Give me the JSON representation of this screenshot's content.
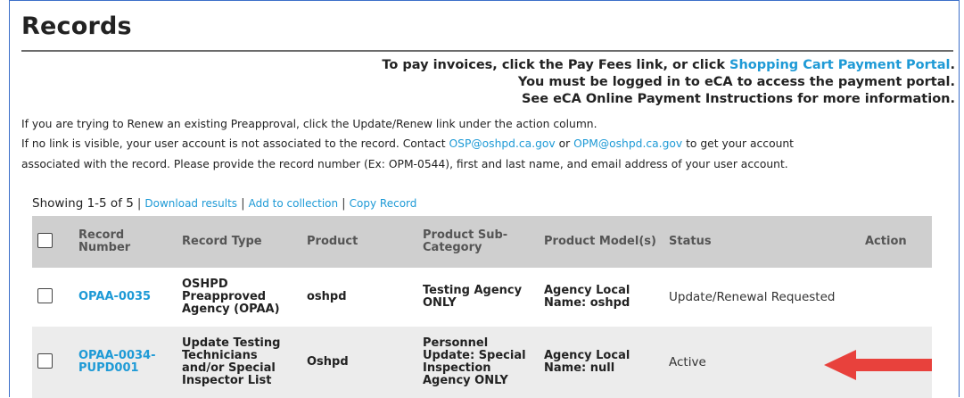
{
  "page": {
    "title": "Records"
  },
  "notice": {
    "line1_prefix": "To pay invoices, click the Pay Fees link, or click ",
    "line1_link": "Shopping Cart Payment Portal",
    "line1_suffix": ".",
    "line2": "You must be logged in to eCA to access the payment portal.",
    "line3": "See eCA Online Payment Instructions for more information."
  },
  "info": {
    "line1": "If you are trying to Renew an existing Preapproval, click the Update/Renew link under the action column.",
    "line2_prefix": "If no link is visible, your user account is not associated to the record.  Contact ",
    "line2_email1": "OSP@oshpd.ca.gov",
    "line2_mid": " or ",
    "line2_email2": "OPM@oshpd.ca.gov",
    "line2_suffix": " to get your account",
    "line3": "associated with the record.  Please provide the record number (Ex: OPM-0544), first and last name, and email address of your user account."
  },
  "results": {
    "showing": "Showing 1-5 of 5",
    "sep": "|",
    "download": "Download results",
    "add_collection": "Add to collection",
    "copy_record": "Copy Record"
  },
  "table": {
    "headers": {
      "record_number": "Record Number",
      "record_type": "Record Type",
      "product": "Product",
      "sub_category": "Product Sub-Category",
      "models": "Product Model(s)",
      "status": "Status",
      "action": "Action"
    },
    "rows": [
      {
        "record_number": "OPAA-0035",
        "record_type": "OSHPD Preapproved Agency (OPAA)",
        "product": "oshpd",
        "sub_category": "Testing Agency ONLY",
        "models": "Agency Local Name: oshpd",
        "status": "Update/Renewal Requested",
        "action": ""
      },
      {
        "record_number": "OPAA-0034-PUPD001",
        "record_type": "Update Testing Technicians and/or Special Inspector List",
        "product": "Oshpd",
        "sub_category": "Personnel Update: Special Inspection Agency ONLY",
        "models": "Agency Local Name: null",
        "status": "Active",
        "action": ""
      }
    ]
  },
  "colors": {
    "link": "#1e9ad6",
    "header_bg": "#cfcfcf",
    "arrow": "#e8413c"
  },
  "icons": {
    "annotation": "red-arrow-left-icon"
  }
}
